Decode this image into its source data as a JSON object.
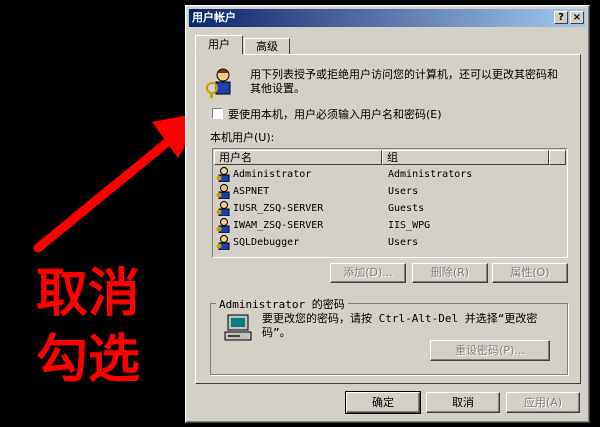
{
  "window": {
    "title": "用户帐户",
    "help_label": "?",
    "close_label": "×"
  },
  "tabs": [
    {
      "label": "用户"
    },
    {
      "label": "高级"
    }
  ],
  "intro_text": "用下列表授予或拒绝用户访问您的计算机，还可以更改其密码和其他设置。",
  "require_login_checkbox": {
    "label": "要使用本机，用户必须输入用户名和密码(E)",
    "checked": false
  },
  "users_label": "本机用户(U):",
  "users_table": {
    "columns": [
      "用户名",
      "组"
    ],
    "rows": [
      {
        "name": "Administrator",
        "group": "Administrators"
      },
      {
        "name": "ASPNET",
        "group": "Users"
      },
      {
        "name": "IUSR_ZSQ-SERVER",
        "group": "Guests"
      },
      {
        "name": "IWAM_ZSQ-SERVER",
        "group": "IIS_WPG"
      },
      {
        "name": "SQLDebugger",
        "group": "Users"
      }
    ]
  },
  "list_buttons": {
    "add": "添加(D)...",
    "remove": "删除(R)",
    "properties": "属性(O)"
  },
  "password_group": {
    "title": "Administrator 的密码",
    "text": "要更改您的密码，请按 Ctrl-Alt-Del 并选择“更改密码”。",
    "reset_button": "重设密码(P)..."
  },
  "footer_buttons": {
    "ok": "确定",
    "cancel": "取消",
    "apply": "应用(A)"
  },
  "annotation": {
    "line1": "取消",
    "line2": "勾选",
    "color": "#ff0000"
  }
}
